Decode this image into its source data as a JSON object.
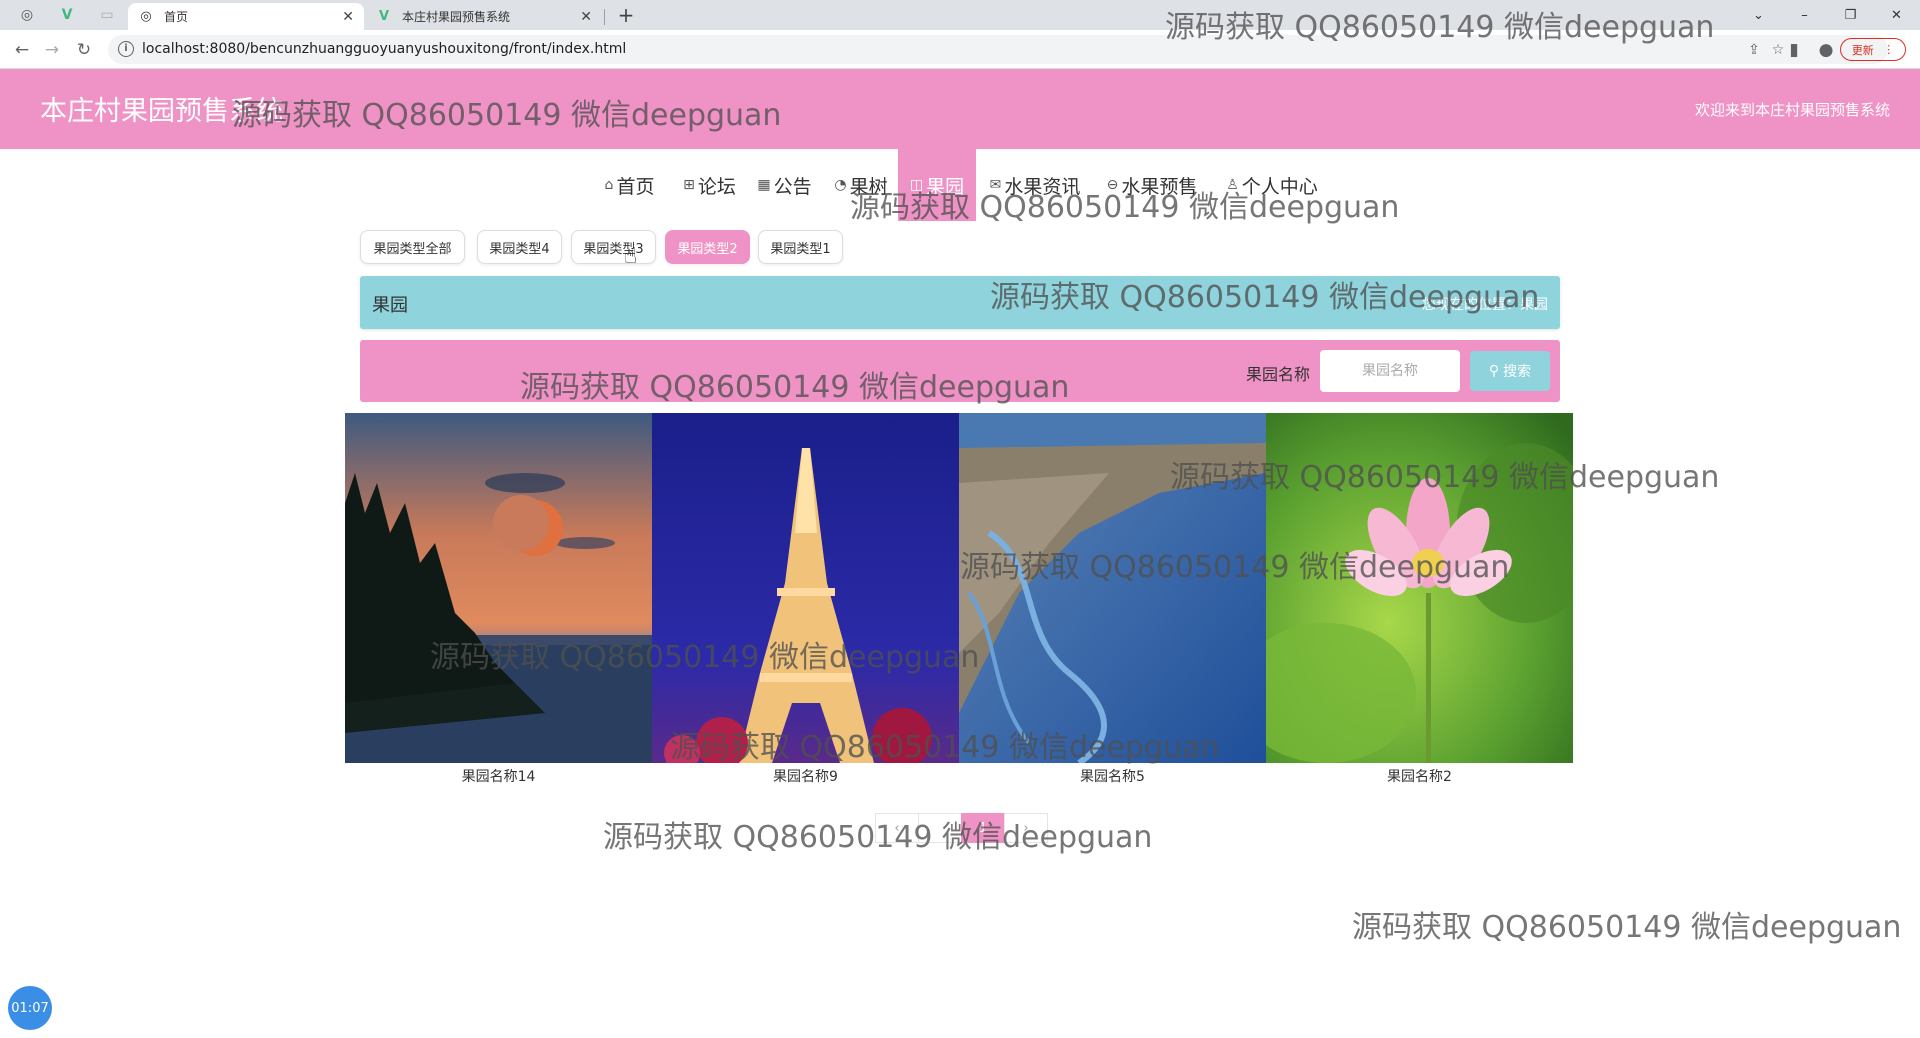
{
  "browser": {
    "tabs": [
      {
        "title": "首页",
        "active": true
      },
      {
        "title": "本庄村果园预售系统",
        "active": false
      }
    ],
    "url": "localhost:8080/bencunzhuangguoyuanyushouxitong/front/index.html",
    "update_label": "更新"
  },
  "header": {
    "title": "本庄村果园预售系统",
    "welcome": "欢迎来到本庄村果园预售系统"
  },
  "menu": [
    {
      "label": "首页",
      "icon": "home-icon",
      "active": false
    },
    {
      "label": "论坛",
      "icon": "forum-icon",
      "active": false
    },
    {
      "label": "公告",
      "icon": "notice-icon",
      "active": false
    },
    {
      "label": "果树",
      "icon": "tree-icon",
      "active": false
    },
    {
      "label": "果园",
      "icon": "orchard-icon",
      "active": true
    },
    {
      "label": "水果资讯",
      "icon": "news-icon",
      "active": false
    },
    {
      "label": "水果预售",
      "icon": "presale-icon",
      "active": false
    },
    {
      "label": "个人中心",
      "icon": "user-icon",
      "active": false
    }
  ],
  "categories": [
    {
      "label": "果园类型全部",
      "active": false
    },
    {
      "label": "果园类型4",
      "active": false
    },
    {
      "label": "果园类型3",
      "active": false
    },
    {
      "label": "果园类型2",
      "active": true
    },
    {
      "label": "果园类型1",
      "active": false
    }
  ],
  "breadcrumb": {
    "title": "果园",
    "path": "您现在的位置：果园"
  },
  "search": {
    "label": "果园名称",
    "placeholder": "果园名称",
    "button_label": "搜索"
  },
  "items": [
    {
      "name": "果园名称14",
      "image": "moonlit-lake-photo"
    },
    {
      "name": "果园名称9",
      "image": "eiffel-tower-photo"
    },
    {
      "name": "果园名称5",
      "image": "coastal-wetland-photo"
    },
    {
      "name": "果园名称2",
      "image": "lotus-flower-photo"
    }
  ],
  "pagination": {
    "pages": [
      "1"
    ],
    "current": "1"
  },
  "watermark": "源码获取 QQ86050149 微信deepguan",
  "timer": "01:07",
  "colors": {
    "primary_pink": "#ef93c6",
    "accent_teal": "#8fd3dc"
  }
}
